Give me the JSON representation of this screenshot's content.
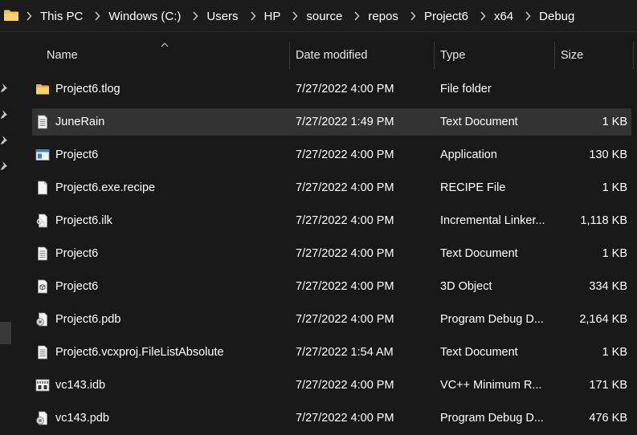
{
  "breadcrumb": [
    "This PC",
    "Windows (C:)",
    "Users",
    "HP",
    "source",
    "repos",
    "Project6",
    "x64",
    "Debug"
  ],
  "columns": {
    "name": "Name",
    "date": "Date modified",
    "type": "Type",
    "size": "Size"
  },
  "files": [
    {
      "name": "Project6.tlog",
      "date": "7/27/2022 4:00 PM",
      "type": "File folder",
      "size": "",
      "icon": "folder-icon"
    },
    {
      "name": "JuneRain",
      "date": "7/27/2022 1:49 PM",
      "type": "Text Document",
      "size": "1 KB",
      "icon": "text-file-icon"
    },
    {
      "name": "Project6",
      "date": "7/27/2022 4:00 PM",
      "type": "Application",
      "size": "130 KB",
      "icon": "application-icon"
    },
    {
      "name": "Project6.exe.recipe",
      "date": "7/27/2022 4:00 PM",
      "type": "RECIPE File",
      "size": "1 KB",
      "icon": "blank-file-icon"
    },
    {
      "name": "Project6.ilk",
      "date": "7/27/2022 4:00 PM",
      "type": "Incremental Linker...",
      "size": "1,118 KB",
      "icon": "linker-file-icon"
    },
    {
      "name": "Project6",
      "date": "7/27/2022 4:00 PM",
      "type": "Text Document",
      "size": "1 KB",
      "icon": "text-file-icon"
    },
    {
      "name": "Project6",
      "date": "7/27/2022 4:00 PM",
      "type": "3D Object",
      "size": "334 KB",
      "icon": "3d-object-icon"
    },
    {
      "name": "Project6.pdb",
      "date": "7/27/2022 4:00 PM",
      "type": "Program Debug D...",
      "size": "2,164 KB",
      "icon": "debug-file-icon"
    },
    {
      "name": "Project6.vcxproj.FileListAbsolute",
      "date": "7/27/2022 1:54 AM",
      "type": "Text Document",
      "size": "1 KB",
      "icon": "text-file-icon"
    },
    {
      "name": "vc143.idb",
      "date": "7/27/2022 4:00 PM",
      "type": "VC++ Minimum R...",
      "size": "171 KB",
      "icon": "idb-file-icon"
    },
    {
      "name": "vc143.pdb",
      "date": "7/27/2022 4:00 PM",
      "type": "Program Debug D...",
      "size": "476 KB",
      "icon": "debug-file-icon"
    }
  ],
  "selected_index": 1,
  "colors": {
    "background": "#191919",
    "selected_row": "#333333",
    "folder": "#f2c44a",
    "text": "#ffffff"
  }
}
